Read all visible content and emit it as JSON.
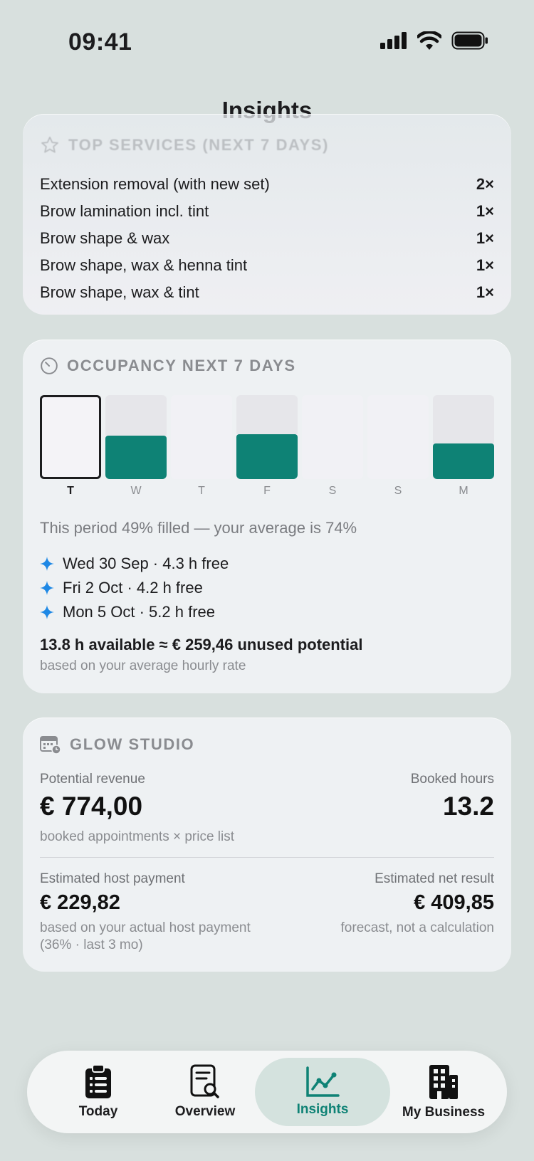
{
  "status_bar": {
    "time": "09:41"
  },
  "page": {
    "title": "Insights"
  },
  "top_services": {
    "heading": "TOP SERVICES (NEXT 7 DAYS)",
    "items": [
      {
        "name": "Extension removal (with new set)",
        "count": "2×"
      },
      {
        "name": "Brow lamination incl. tint",
        "count": "1×"
      },
      {
        "name": "Brow shape & wax",
        "count": "1×"
      },
      {
        "name": "Brow shape, wax & henna tint",
        "count": "1×"
      },
      {
        "name": "Brow shape, wax & tint",
        "count": "1×"
      }
    ]
  },
  "occupancy": {
    "heading": "OCCUPANCY NEXT 7 DAYS",
    "days": [
      {
        "label": "T",
        "booked_fraction": 0,
        "has_hours": true,
        "selected": true
      },
      {
        "label": "W",
        "booked_fraction": 0.52,
        "has_hours": true,
        "selected": false
      },
      {
        "label": "T",
        "booked_fraction": 0,
        "has_hours": false,
        "selected": false
      },
      {
        "label": "F",
        "booked_fraction": 0.53,
        "has_hours": true,
        "selected": false
      },
      {
        "label": "S",
        "booked_fraction": 0,
        "has_hours": false,
        "selected": false
      },
      {
        "label": "S",
        "booked_fraction": 0,
        "has_hours": false,
        "selected": false
      },
      {
        "label": "M",
        "booked_fraction": 0.42,
        "has_hours": true,
        "selected": false
      }
    ],
    "summary": "This period 49% filled — your average is 74%",
    "free_slots": [
      "Wed 30 Sep · 4.3 h free",
      "Fri 2 Oct · 4.2 h free",
      "Mon 5 Oct · 5.2 h free"
    ],
    "potential": "13.8 h available ≈ € 259,46 unused potential",
    "potential_note": "based on your average hourly rate",
    "colors": {
      "booked": "#0e8275",
      "sparkle": "#1e88e5"
    }
  },
  "studio": {
    "heading": "GLOW STUDIO",
    "revenue_label": "Potential revenue",
    "revenue_value": "€ 774,00",
    "revenue_note": "booked appointments × price list",
    "hours_label": "Booked hours",
    "hours_value": "13.2",
    "host_label": "Estimated host payment",
    "host_value": "€ 229,82",
    "host_note_1": "based on your actual host payment",
    "host_note_2": "(36% · last 3 mo)",
    "net_label": "Estimated net result",
    "net_value": "€ 409,85",
    "net_note": "forecast, not a calculation"
  },
  "tabbar": {
    "tabs": [
      {
        "label": "Today",
        "icon": "clipboard-icon"
      },
      {
        "label": "Overview",
        "icon": "document-search-icon"
      },
      {
        "label": "Insights",
        "icon": "chart-line-icon",
        "active": true
      },
      {
        "label": "My Business",
        "icon": "building-icon"
      }
    ]
  }
}
